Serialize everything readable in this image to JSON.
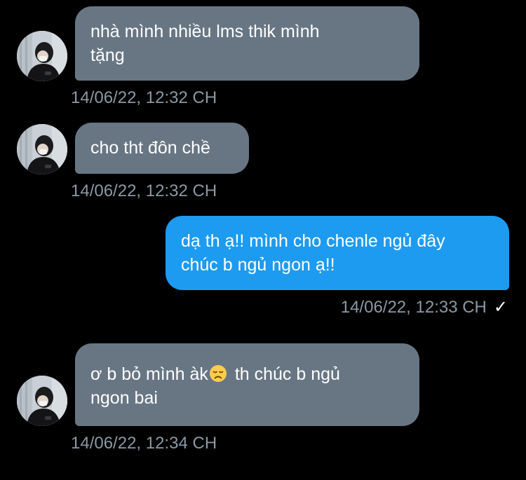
{
  "conversation": {
    "messages": [
      {
        "direction": "received",
        "lines": [
          "nhà mình nhiều lms thik mình",
          "tặng"
        ],
        "timestamp": "14/06/22, 12:32 CH"
      },
      {
        "direction": "received",
        "lines": [
          "cho tht đôn chề"
        ],
        "timestamp": "14/06/22, 12:32 CH"
      },
      {
        "direction": "sent",
        "lines": [
          "dạ th ạ!! mình cho chenle ngủ đây",
          "chúc b ngủ ngon ạ!!"
        ],
        "timestamp": "14/06/22, 12:33 CH",
        "status_icon": "check-icon",
        "status_glyph": "✓"
      },
      {
        "direction": "received",
        "line1_before_emoji": "ơ b bỏ mình àk",
        "emoji": "disappointed-face-emoji",
        "line1_after_emoji": " th chúc b ngủ",
        "line2": "ngon bai",
        "timestamp": "14/06/22, 12:34 CH"
      }
    ]
  },
  "colors": {
    "background": "#000000",
    "received_bubble": "#687684",
    "sent_bubble": "#1d9bf0",
    "timestamp_text": "#8b98a5",
    "message_text": "#ffffff"
  }
}
